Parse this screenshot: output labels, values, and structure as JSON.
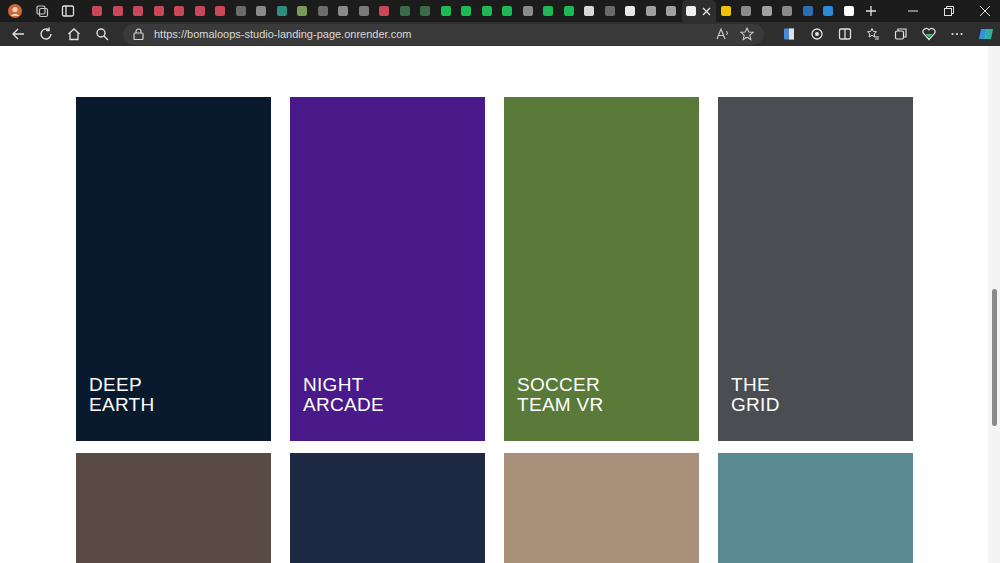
{
  "browser": {
    "tabs": [
      {
        "selected": false,
        "color": "#c8485a"
      },
      {
        "selected": false,
        "color": "#c8485a"
      },
      {
        "selected": false,
        "color": "#c8485a"
      },
      {
        "selected": false,
        "color": "#c8485a"
      },
      {
        "selected": false,
        "color": "#c8485a"
      },
      {
        "selected": false,
        "color": "#c8485a"
      },
      {
        "selected": false,
        "color": "#c8485a"
      },
      {
        "selected": false,
        "color": "#6b6b6b"
      },
      {
        "selected": false,
        "color": "#8a8a8a"
      },
      {
        "selected": false,
        "color": "#2f8f7f"
      },
      {
        "selected": false,
        "color": "#7a9a5a"
      },
      {
        "selected": false,
        "color": "#6b6b6b"
      },
      {
        "selected": false,
        "color": "#8a8a8a"
      },
      {
        "selected": false,
        "color": "#7a7a7a"
      },
      {
        "selected": false,
        "color": "#c8485a"
      },
      {
        "selected": false,
        "color": "#3d6b4a"
      },
      {
        "selected": false,
        "color": "#3d6b4a"
      },
      {
        "selected": false,
        "color": "#1db954"
      },
      {
        "selected": false,
        "color": "#1db954"
      },
      {
        "selected": false,
        "color": "#1db954"
      },
      {
        "selected": false,
        "color": "#1db954"
      },
      {
        "selected": false,
        "color": "#8a8a8a"
      },
      {
        "selected": false,
        "color": "#1db954"
      },
      {
        "selected": false,
        "color": "#1db954"
      },
      {
        "selected": false,
        "color": "#d8d8d8"
      },
      {
        "selected": false,
        "color": "#6b6b6b"
      },
      {
        "selected": false,
        "color": "#e8e8e8"
      },
      {
        "selected": false,
        "color": "#a0a0a0"
      },
      {
        "selected": false,
        "color": "#a0a0a0"
      },
      {
        "selected": true,
        "color": "#f0f0f0"
      },
      {
        "selected": false,
        "color": "#f2c200"
      },
      {
        "selected": false,
        "color": "#8a8a8a"
      },
      {
        "selected": false,
        "color": "#a0a0a0"
      },
      {
        "selected": false,
        "color": "#8a8a8a"
      },
      {
        "selected": false,
        "color": "#2a6fb0"
      },
      {
        "selected": false,
        "color": "#2a8ad8"
      },
      {
        "selected": false,
        "color": "#ffffff"
      }
    ],
    "url": "https://bomaloops-studio-landing-page.onrender.com"
  },
  "page": {
    "cards": [
      {
        "lines": [
          "DEEP",
          "EARTH"
        ],
        "color": "#0a1a2e"
      },
      {
        "lines": [
          "NIGHT",
          "ARCADE"
        ],
        "color": "#4a1a8a"
      },
      {
        "lines": [
          "SOCCER",
          "TEAM VR"
        ],
        "color": "#5a7a3a"
      },
      {
        "lines": [
          "THE",
          "GRID"
        ],
        "color": "#4a4e52"
      },
      {
        "lines": [],
        "color": "#5a4a46"
      },
      {
        "lines": [],
        "color": "#1e2a44"
      },
      {
        "lines": [],
        "color": "#a8907a"
      },
      {
        "lines": [],
        "color": "#5a8a94"
      }
    ],
    "scrollbar": {
      "level": 0.64
    }
  }
}
